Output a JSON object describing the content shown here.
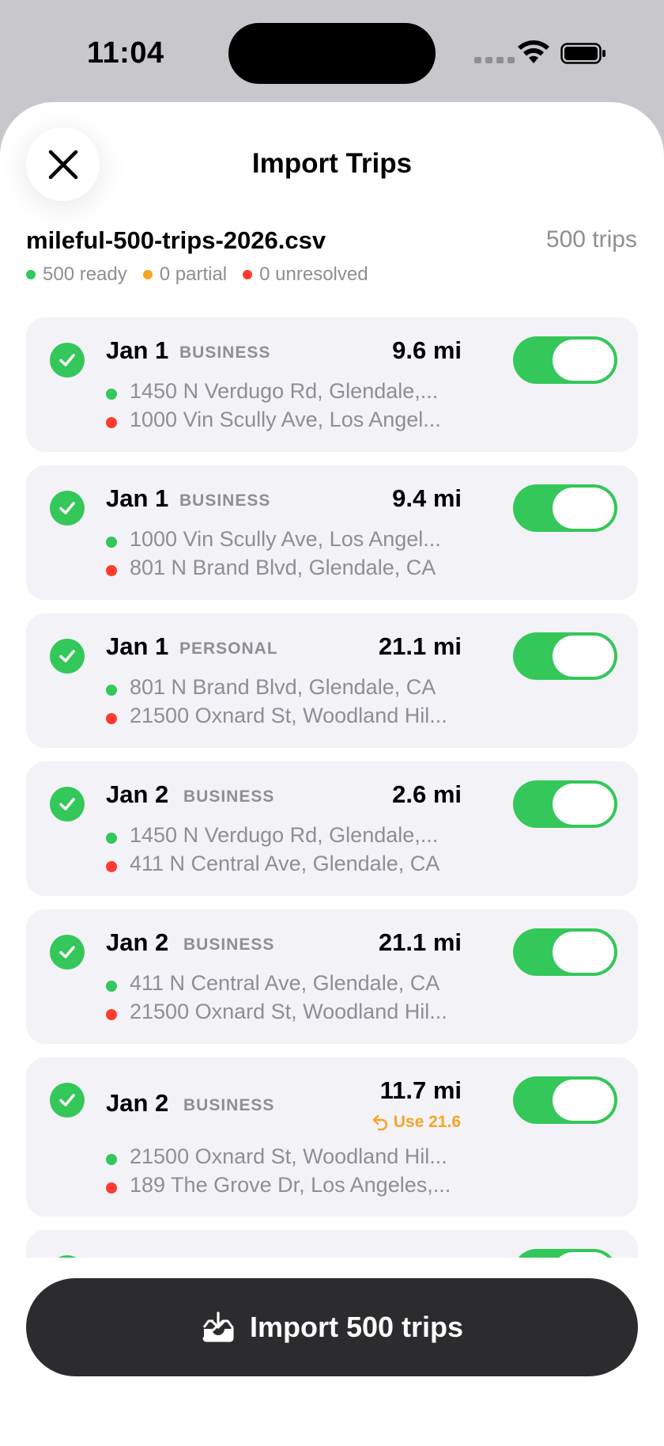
{
  "status_bar": {
    "time": "11:04"
  },
  "sheet": {
    "title": "Import Trips"
  },
  "file": {
    "name": "mileful-500-trips-2026.csv",
    "trip_count": "500 trips",
    "ready": "500 ready",
    "partial": "0 partial",
    "unresolved": "0 unresolved"
  },
  "colors": {
    "green": "#34c759",
    "orange": "#f5a623",
    "red": "#ff3b30",
    "button": "#2c2c2e"
  },
  "trips": [
    {
      "date": "Jan 1",
      "category": "BUSINESS",
      "distance": "9.6 mi",
      "from": "1450 N Verdugo Rd, Glendale,...",
      "to": "1000 Vin Scully Ave, Los Angel...",
      "suggestion": ""
    },
    {
      "date": "Jan 1",
      "category": "BUSINESS",
      "distance": "9.4 mi",
      "from": "1000 Vin Scully Ave, Los Angel...",
      "to": "801 N Brand Blvd, Glendale, CA",
      "suggestion": ""
    },
    {
      "date": "Jan 1",
      "category": "PERSONAL",
      "distance": "21.1 mi",
      "from": "801 N Brand Blvd, Glendale, CA",
      "to": "21500 Oxnard St, Woodland Hil...",
      "suggestion": ""
    },
    {
      "date": "Jan 2",
      "category": "BUSINESS",
      "distance": "2.6 mi",
      "from": "1450 N Verdugo Rd, Glendale,...",
      "to": "411 N Central Ave, Glendale, CA",
      "suggestion": ""
    },
    {
      "date": "Jan 2",
      "category": "BUSINESS",
      "distance": "21.1 mi",
      "from": "411 N Central Ave, Glendale, CA",
      "to": "21500 Oxnard St, Woodland Hil...",
      "suggestion": ""
    },
    {
      "date": "Jan 2",
      "category": "BUSINESS",
      "distance": "11.7 mi",
      "from": "21500 Oxnard St, Woodland Hil...",
      "to": "189 The Grove Dr, Los Angeles,...",
      "suggestion": "Use 21.6"
    }
  ],
  "import_button": {
    "label": "Import 500 trips"
  }
}
